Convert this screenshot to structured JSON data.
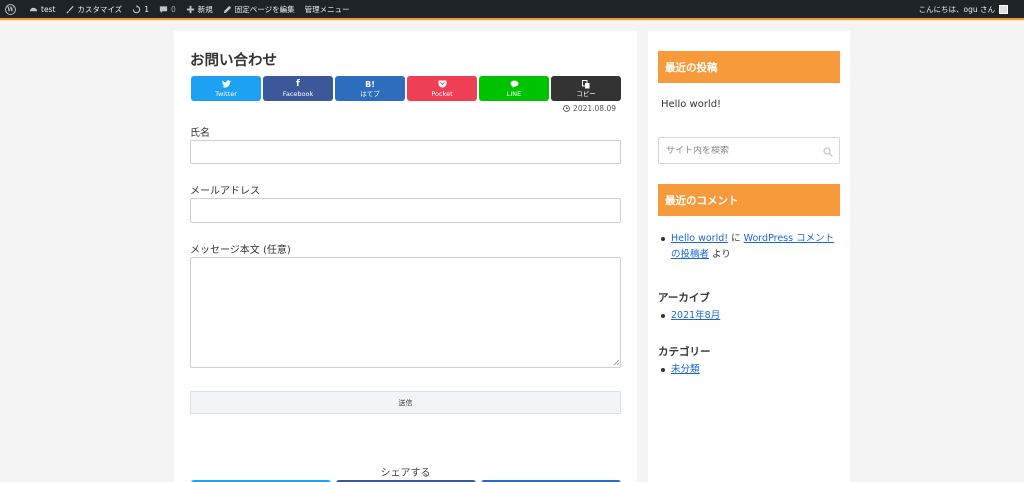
{
  "adminbar": {
    "site_name": "test",
    "customize": "カスタマイズ",
    "updates_count": "1",
    "comments_count": "0",
    "new_label": "新規",
    "edit_page": "固定ページを編集",
    "admin_menu": "管理メニュー",
    "greeting": "こんにちは、ogu さん"
  },
  "main": {
    "title": "お問い合わせ",
    "share_buttons": [
      {
        "icon": "t",
        "label": "Twitter",
        "color": "#1da1f2"
      },
      {
        "icon": "f",
        "label": "Facebook",
        "color": "#3b5998"
      },
      {
        "icon": "B!",
        "label": "はてブ",
        "color": "#2c6ebd"
      },
      {
        "icon": "P",
        "label": "Pocket",
        "color": "#ef3f56"
      },
      {
        "icon": "L",
        "label": "LINE",
        "color": "#00c300"
      },
      {
        "icon": "C",
        "label": "コピー",
        "color": "#333333"
      }
    ],
    "date": "2021.08.09",
    "form": {
      "name_label": "氏名",
      "email_label": "メールアドレス",
      "message_label": "メッセージ本文 (任意)",
      "name_value": "",
      "email_value": "",
      "message_value": "",
      "submit_label": "送信"
    },
    "share_label": "シェアする"
  },
  "sidebar": {
    "recent_posts_title": "最近の投稿",
    "recent_post": "Hello world!",
    "search_placeholder": "サイト内を検索",
    "recent_comments_title": "最近のコメント",
    "comment": {
      "post_link": "Hello world!",
      "on": "に",
      "author_link": "WordPress コメントの投稿者",
      "suffix": "より"
    },
    "archives_title": "アーカイブ",
    "archive_item": "2021年8月",
    "categories_title": "カテゴリー",
    "category_item": "未分類"
  },
  "colors": {
    "accent": "#f79a3b",
    "adminbar": "#1d2327",
    "link": "#1967d2"
  }
}
